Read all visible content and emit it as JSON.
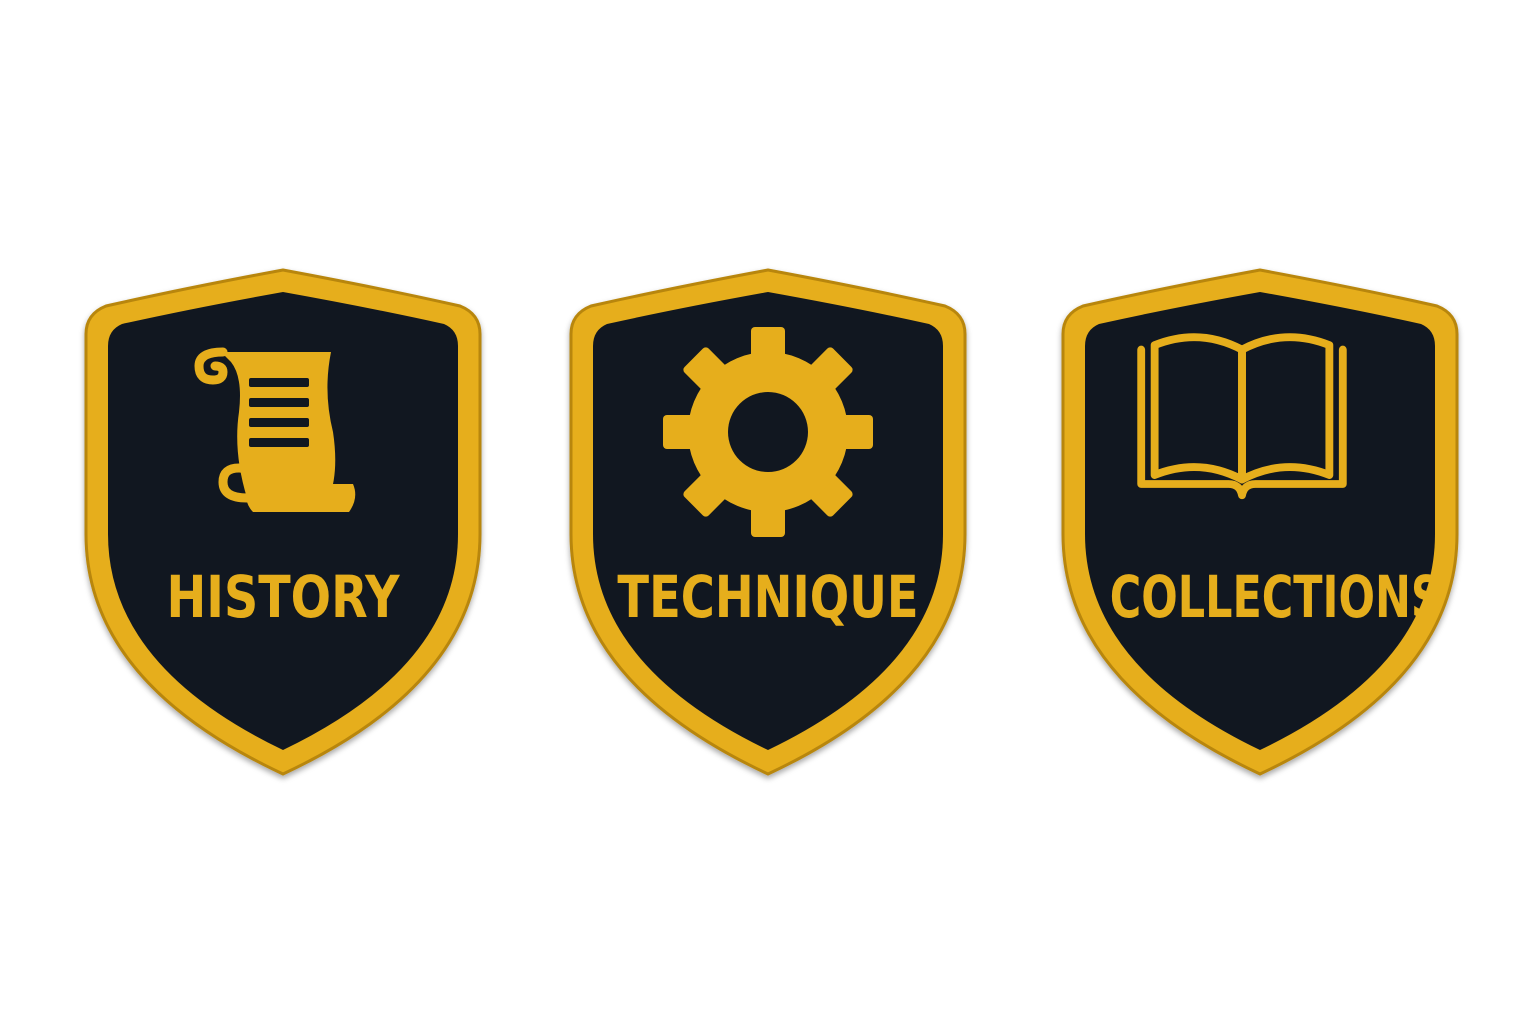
{
  "colors": {
    "background": "#ffffff",
    "badge_fill": "#111720",
    "thread_gold": "#e6ae1c",
    "thread_gold_dark": "#b8860b"
  },
  "badges": [
    {
      "label": "HISTORY",
      "icon": "scroll-icon"
    },
    {
      "label": "TECHNIQUE",
      "icon": "gear-icon"
    },
    {
      "label": "COLLECTIONS",
      "icon": "open-book-icon"
    }
  ]
}
